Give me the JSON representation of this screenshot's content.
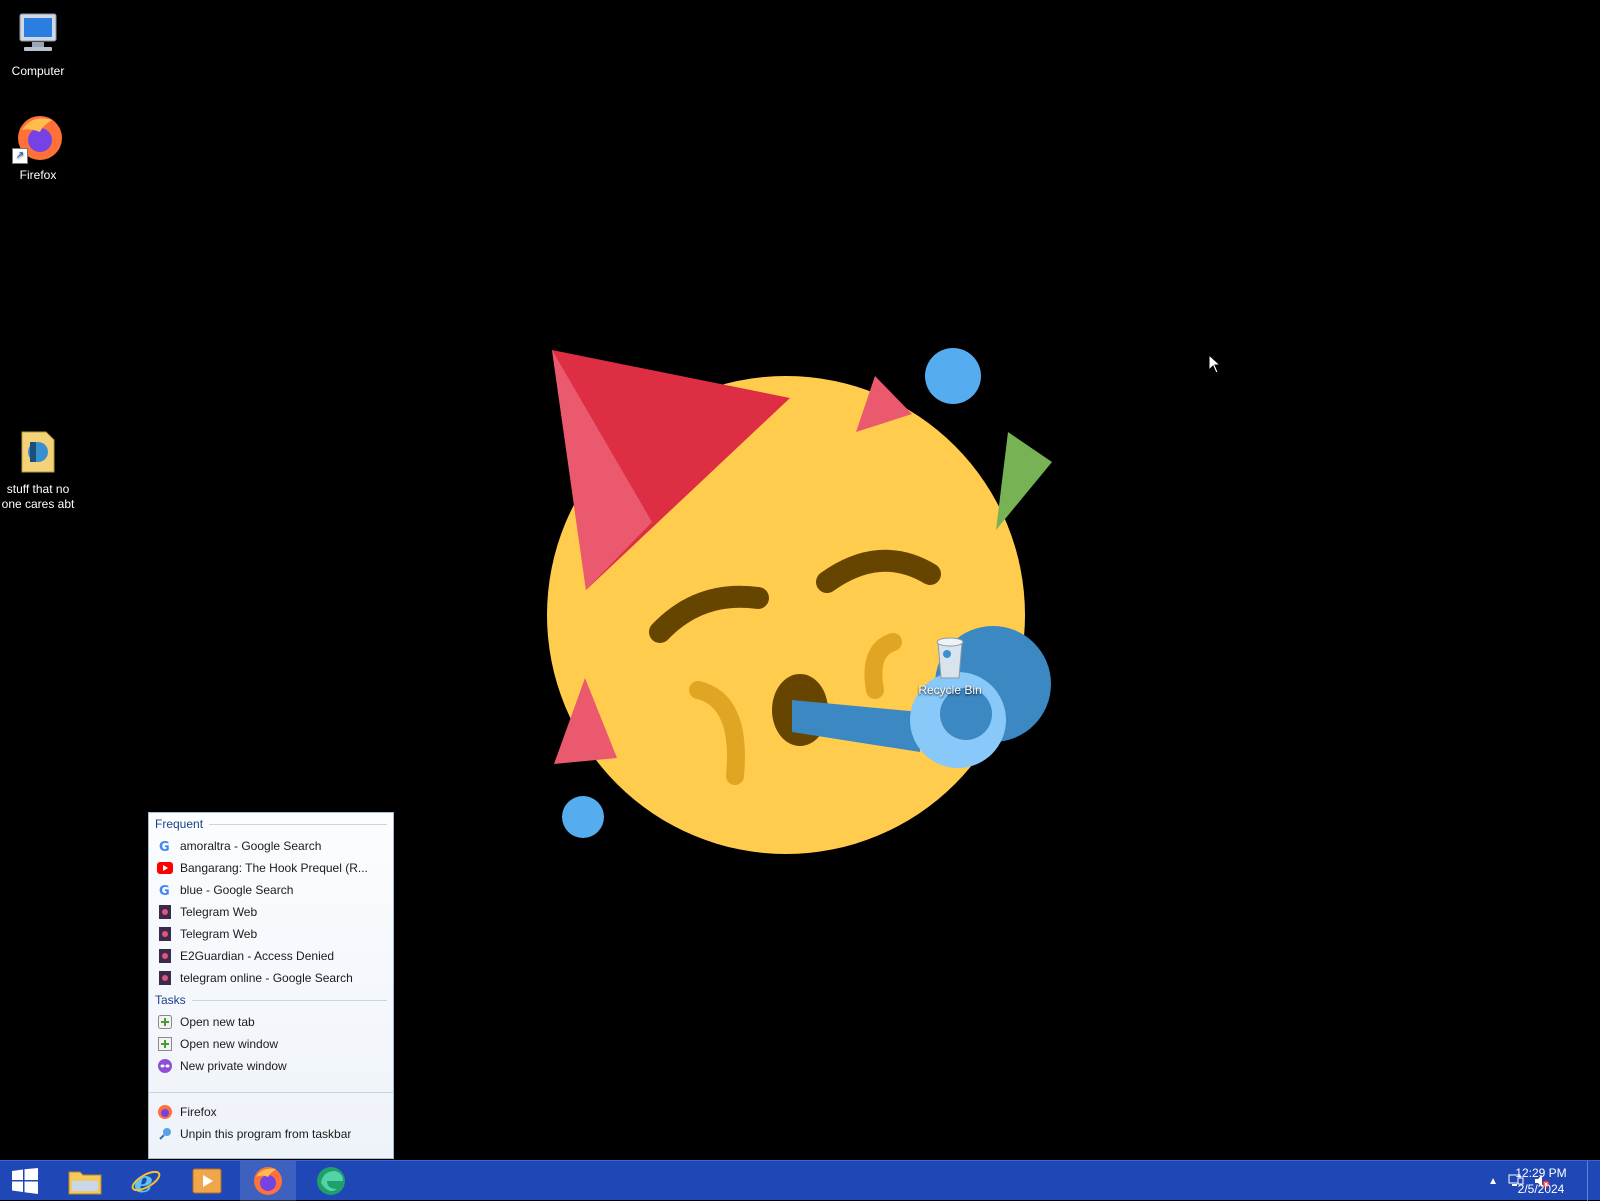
{
  "desktop": {
    "icons": [
      {
        "label": "Computer",
        "icon": "computer-icon"
      },
      {
        "label": "Firefox",
        "icon": "firefox-icon"
      },
      {
        "label": "stuff that no one cares abt",
        "icon": "folder-icon"
      }
    ],
    "recycle_bin": {
      "label": "Recycle Bin",
      "icon": "recycle-bin-icon"
    },
    "wallpaper": "party-face-emoji"
  },
  "jumplist": {
    "frequent_header": "Frequent",
    "frequent": [
      {
        "label": "amoraltra - Google Search",
        "icon": "google-icon"
      },
      {
        "label": "Bangarang: The Hook Prequel (R...",
        "icon": "youtube-icon"
      },
      {
        "label": "blue - Google Search",
        "icon": "google-icon"
      },
      {
        "label": "Telegram Web",
        "icon": "page-icon"
      },
      {
        "label": "Telegram Web",
        "icon": "page-icon"
      },
      {
        "label": "E2Guardian - Access Denied",
        "icon": "page-icon"
      },
      {
        "label": "telegram online - Google Search",
        "icon": "page-icon"
      }
    ],
    "tasks_header": "Tasks",
    "tasks": [
      {
        "label": "Open new tab",
        "icon": "new-tab-icon"
      },
      {
        "label": "Open new window",
        "icon": "new-window-icon"
      },
      {
        "label": "New private window",
        "icon": "private-window-icon"
      }
    ],
    "bottom": [
      {
        "label": "Firefox",
        "icon": "firefox-icon"
      },
      {
        "label": "Unpin this program from taskbar",
        "icon": "unpin-icon"
      }
    ]
  },
  "taskbar": {
    "apps": [
      "windows-start-icon",
      "file-explorer-icon",
      "internet-explorer-icon",
      "media-player-icon",
      "firefox-icon",
      "edge-icon"
    ],
    "active_app": "firefox-icon",
    "tray": [
      "show-hidden-icons-icon",
      "network-icon",
      "volume-muted-icon"
    ],
    "clock": {
      "time": "12:29 PM",
      "date": "2/5/2024"
    }
  },
  "colors": {
    "taskbar": "#1f47b5",
    "emoji_face": "#ffcc4d",
    "hat": "#dd2e44",
    "confetti_blue": "#55acee",
    "confetti_green": "#77b255"
  }
}
